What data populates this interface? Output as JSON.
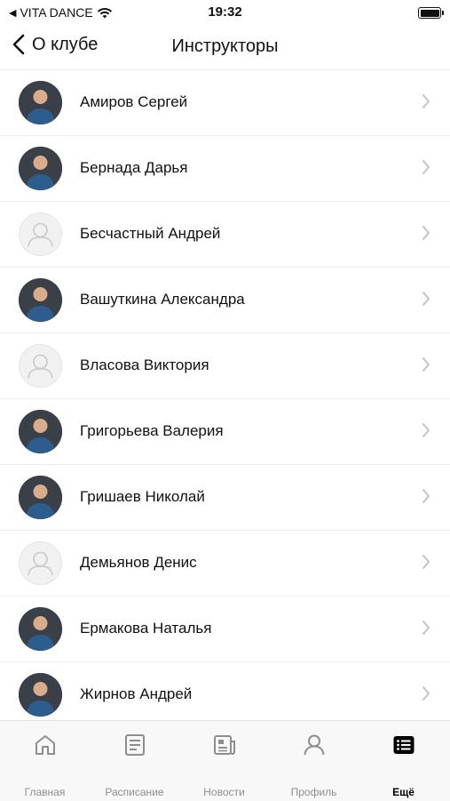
{
  "status_bar": {
    "carrier": "VITA DANCE",
    "time": "19:32"
  },
  "nav": {
    "back_label": "О клубе",
    "title": "Инструкторы"
  },
  "instructors": [
    {
      "name": "Амиров  Сергей",
      "avatar": "photo"
    },
    {
      "name": "Бернада  Дарья",
      "avatar": "photo"
    },
    {
      "name": "Бесчастный  Андрей",
      "avatar": "placeholder"
    },
    {
      "name": "Вашуткина Александра",
      "avatar": "photo"
    },
    {
      "name": "Власова Виктория",
      "avatar": "placeholder"
    },
    {
      "name": "Григорьева Валерия",
      "avatar": "photo"
    },
    {
      "name": "Гришаев Николай",
      "avatar": "photo"
    },
    {
      "name": "Демьянов  Денис",
      "avatar": "placeholder"
    },
    {
      "name": "Ермакова  Наталья",
      "avatar": "photo"
    },
    {
      "name": "Жирнов Андрей",
      "avatar": "photo"
    },
    {
      "name": "",
      "avatar": "photo"
    }
  ],
  "tabs": [
    {
      "label": "Главная",
      "icon": "home-icon"
    },
    {
      "label": "Расписание",
      "icon": "schedule-icon"
    },
    {
      "label": "Новости",
      "icon": "news-icon"
    },
    {
      "label": "Профиль",
      "icon": "profile-icon"
    },
    {
      "label": "Ещё",
      "icon": "more-icon",
      "active": true
    }
  ]
}
